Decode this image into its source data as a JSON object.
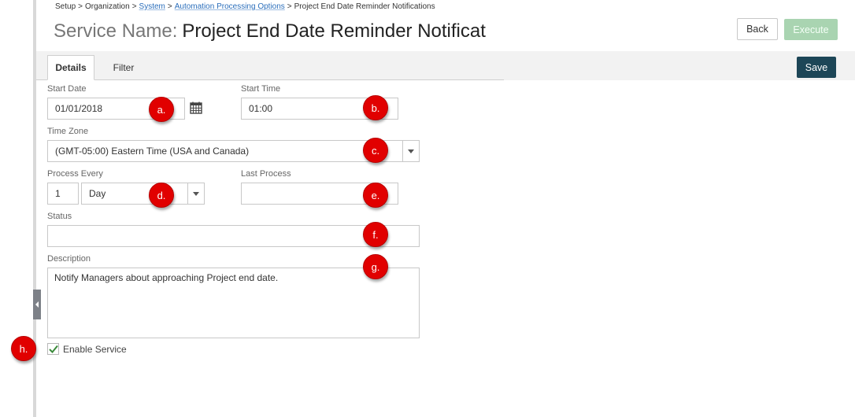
{
  "breadcrumb": {
    "setup": "Setup",
    "organization": "Organization",
    "system": "System",
    "automation": "Automation Processing Options",
    "current": "Project End Date Reminder Notifications",
    "separator": ">"
  },
  "header": {
    "title_label": "Service Name:",
    "title_value": "Project End Date Reminder Notificat",
    "back_label": "Back",
    "execute_label": "Execute",
    "save_label": "Save"
  },
  "tabs": [
    {
      "label": "Details",
      "active": true
    },
    {
      "label": "Filter",
      "active": false
    }
  ],
  "form": {
    "start_date_label": "Start Date",
    "start_date_value": "01/01/2018",
    "start_time_label": "Start Time",
    "start_time_value": "01:00",
    "time_zone_label": "Time Zone",
    "time_zone_value": "(GMT-05:00) Eastern Time (USA and Canada)",
    "process_every_label": "Process Every",
    "process_every_number": "1",
    "process_every_unit": "Day",
    "last_process_label": "Last Process",
    "last_process_value": "",
    "status_label": "Status",
    "status_value": "",
    "description_label": "Description",
    "description_value": "Notify Managers about approaching Project end date.",
    "enable_service_label": "Enable Service",
    "enable_service_checked": true
  },
  "markers": [
    "a.",
    "b.",
    "c.",
    "d.",
    "e.",
    "f.",
    "g.",
    "h."
  ],
  "colors": {
    "link": "#2a6ebb",
    "save_button": "#1d4657",
    "execute_button_disabled": "#a9d4b1",
    "marker": "#e10000",
    "checkmark": "#3a8a3a"
  },
  "icons": {
    "calendar": "calendar-icon",
    "dropdown": "chevron-down-icon",
    "collapse": "chevron-left-icon",
    "check": "checkmark-icon"
  }
}
